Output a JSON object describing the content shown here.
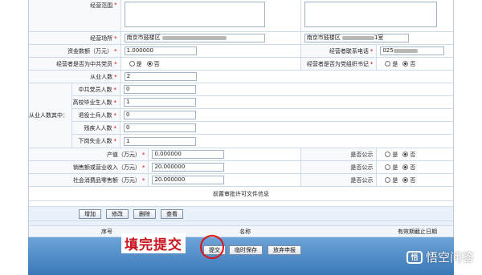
{
  "form": {
    "business_scope": {
      "label": "经营范围",
      "required": "*"
    },
    "business_place": {
      "label": "经营场所",
      "required": "*",
      "value": "南京市鼓楼区",
      "right_value": "南京市鼓楼区",
      "right_suffix": "1室"
    },
    "capital": {
      "label": "资金数额（万元）",
      "required": "*",
      "value": "1.000000"
    },
    "contact_phone": {
      "label": "经营者联系电话",
      "required": "*",
      "value": "025"
    },
    "party_member": {
      "label": "经营者是否为中共党员",
      "required": "*",
      "yes": "是",
      "no": "否"
    },
    "party_secretary": {
      "label": "经营者是否为党组织书记",
      "required": "*",
      "yes": "是",
      "no": "否"
    },
    "employees": {
      "label": "从业人数",
      "required": "*",
      "value": "2"
    },
    "employees_group_label": "从业人数其中：",
    "sub_rows": [
      {
        "label": "中共党员人数",
        "required": "*",
        "value": "0"
      },
      {
        "label": "高校毕业生人数",
        "required": "*",
        "value": "1"
      },
      {
        "label": "退役士兵人数",
        "required": "*",
        "value": "0"
      },
      {
        "label": "残疾人人数",
        "required": "*",
        "value": "0"
      },
      {
        "label": "下岗失业人数",
        "required": "*",
        "value": "1"
      }
    ],
    "output_value": {
      "label": "产值（万元）",
      "required": "*",
      "value": "0.000000",
      "public_label": "是否公示",
      "yes": "是",
      "no": "否"
    },
    "sales": {
      "label": "销售额或营业收入（万元）",
      "required": "*",
      "value": "20.000000",
      "public_label": "是否公示",
      "yes": "是",
      "no": "否"
    },
    "retail": {
      "label": "社会消费品零售额（万元）",
      "required": "*",
      "value": "20.000000",
      "public_label": "是否公示",
      "yes": "是",
      "no": "否"
    }
  },
  "pre_approval": {
    "title": "前置审批许可文件信息",
    "buttons": [
      "增加",
      "修改",
      "删除",
      "查看"
    ],
    "columns": [
      "序号",
      "名称",
      "有效期截止日期"
    ]
  },
  "bottom": {
    "submit": "提交",
    "temp_save": "临时保存",
    "abandon": "放弃申报"
  },
  "annotation": "填完提交",
  "watermark": {
    "logo": "悟",
    "text": "悟空问答"
  }
}
